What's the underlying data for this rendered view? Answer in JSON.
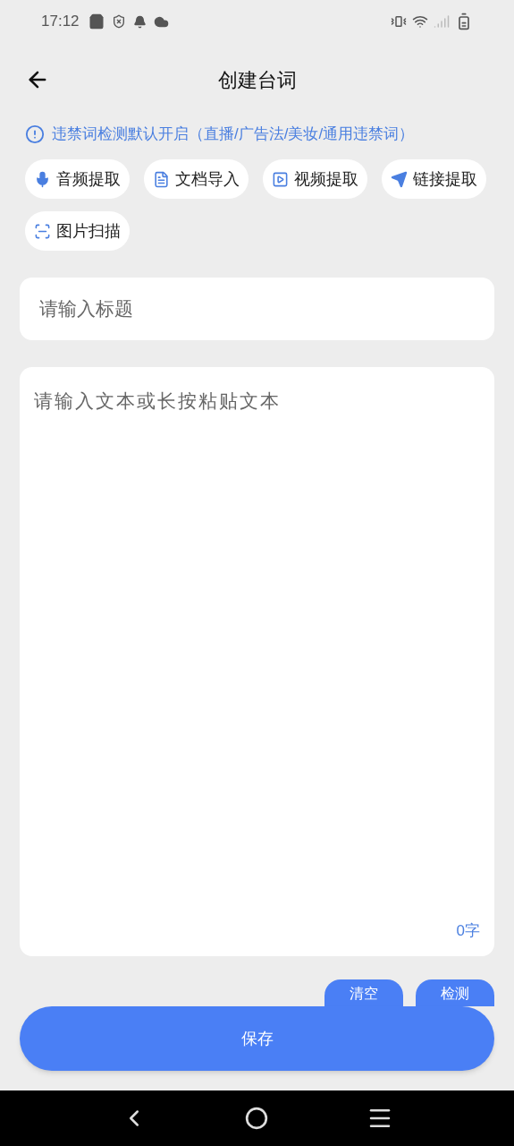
{
  "status_bar": {
    "time": "17:12"
  },
  "header": {
    "title": "创建台词"
  },
  "notice": "违禁词检测默认开启（直播/广告法/美妆/通用违禁词）",
  "import_buttons": [
    {
      "kind": "audio",
      "label": "音频提取"
    },
    {
      "kind": "document",
      "label": "文档导入"
    },
    {
      "kind": "video",
      "label": "视频提取"
    },
    {
      "kind": "link",
      "label": "链接提取"
    },
    {
      "kind": "image",
      "label": "图片扫描"
    }
  ],
  "title_field": {
    "placeholder": "请输入标题"
  },
  "text_field": {
    "placeholder": "请输入文本或长按粘贴文本",
    "count": "0字"
  },
  "actions": [
    "清空",
    "检测"
  ],
  "save_button": "保存"
}
